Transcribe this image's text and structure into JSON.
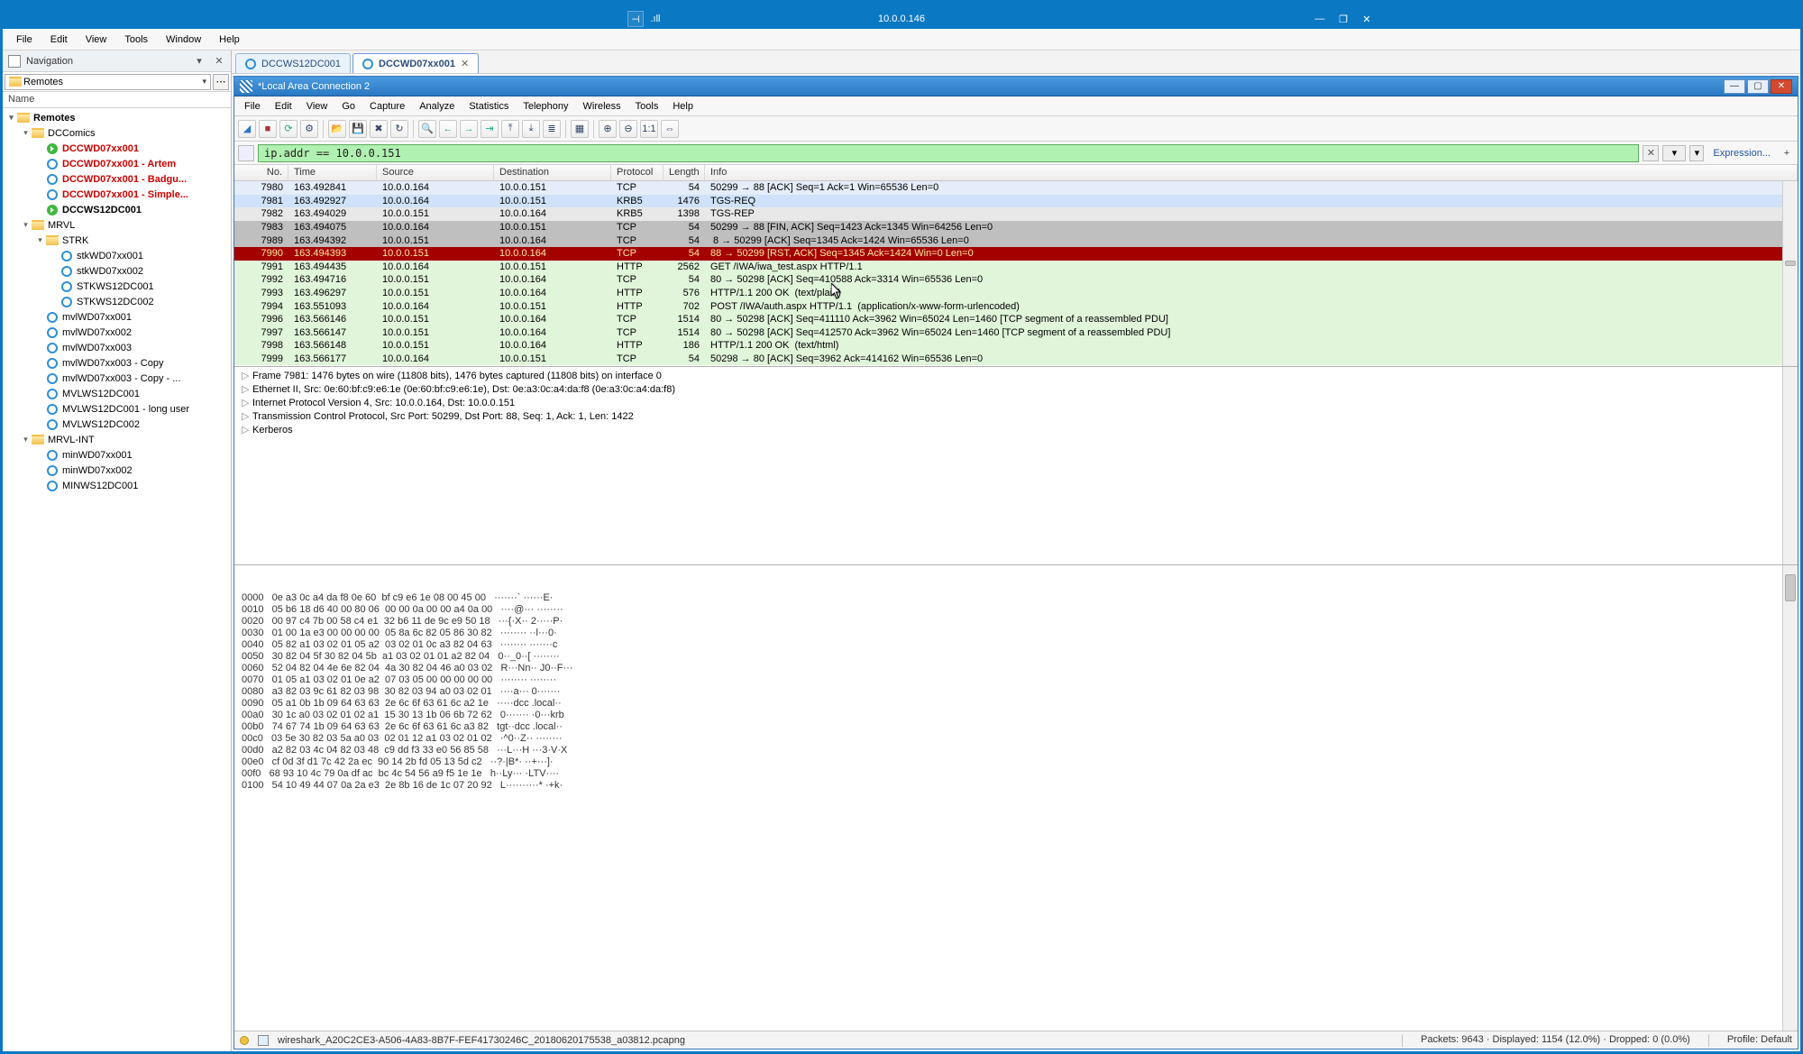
{
  "rdp": {
    "ip": "10.0.0.146",
    "pin_icon": "⊣",
    "signal_icon": "▮▮▮"
  },
  "app_menu": [
    "File",
    "Edit",
    "View",
    "Tools",
    "Window",
    "Help"
  ],
  "nav": {
    "title": "Navigation",
    "combo": "Remotes",
    "col": "Name",
    "tree": [
      {
        "lvl": 0,
        "exp": "▾",
        "type": "folder",
        "label": "Remotes",
        "bold": true
      },
      {
        "lvl": 1,
        "exp": "▾",
        "type": "folder",
        "label": "DCComics"
      },
      {
        "lvl": 2,
        "exp": "",
        "type": "play",
        "label": "DCCWD07xx001",
        "red": true,
        "bold": true
      },
      {
        "lvl": 2,
        "exp": "",
        "type": "off",
        "label": "DCCWD07xx001 - Artem",
        "red": true
      },
      {
        "lvl": 2,
        "exp": "",
        "type": "off",
        "label": "DCCWD07xx001 - Badgu...",
        "red": true
      },
      {
        "lvl": 2,
        "exp": "",
        "type": "off",
        "label": "DCCWD07xx001 - Simple...",
        "red": true
      },
      {
        "lvl": 2,
        "exp": "",
        "type": "play",
        "label": "DCCWS12DC001",
        "bold": true
      },
      {
        "lvl": 1,
        "exp": "▾",
        "type": "folder",
        "label": "MRVL"
      },
      {
        "lvl": 2,
        "exp": "▾",
        "type": "folder",
        "label": "STRK"
      },
      {
        "lvl": 3,
        "exp": "",
        "type": "off",
        "label": "stkWD07xx001"
      },
      {
        "lvl": 3,
        "exp": "",
        "type": "off",
        "label": "stkWD07xx002"
      },
      {
        "lvl": 3,
        "exp": "",
        "type": "off",
        "label": "STKWS12DC001"
      },
      {
        "lvl": 3,
        "exp": "",
        "type": "off",
        "label": "STKWS12DC002"
      },
      {
        "lvl": 2,
        "exp": "",
        "type": "off",
        "label": "mvlWD07xx001"
      },
      {
        "lvl": 2,
        "exp": "",
        "type": "off",
        "label": "mvlWD07xx002"
      },
      {
        "lvl": 2,
        "exp": "",
        "type": "off",
        "label": "mvlWD07xx003"
      },
      {
        "lvl": 2,
        "exp": "",
        "type": "off",
        "label": "mvlWD07xx003 - Copy"
      },
      {
        "lvl": 2,
        "exp": "",
        "type": "off",
        "label": "mvlWD07xx003 - Copy - ..."
      },
      {
        "lvl": 2,
        "exp": "",
        "type": "off",
        "label": "MVLWS12DC001"
      },
      {
        "lvl": 2,
        "exp": "",
        "type": "off",
        "label": "MVLWS12DC001 - long user"
      },
      {
        "lvl": 2,
        "exp": "",
        "type": "off",
        "label": "MVLWS12DC002"
      },
      {
        "lvl": 1,
        "exp": "▾",
        "type": "folder",
        "label": "MRVL-INT"
      },
      {
        "lvl": 2,
        "exp": "",
        "type": "off",
        "label": "minWD07xx001"
      },
      {
        "lvl": 2,
        "exp": "",
        "type": "off",
        "label": "minWD07xx002"
      },
      {
        "lvl": 2,
        "exp": "",
        "type": "off",
        "label": "MINWS12DC001"
      }
    ]
  },
  "tabs": [
    {
      "label": "DCCWS12DC001",
      "active": false
    },
    {
      "label": "DCCWD07xx001",
      "active": true
    }
  ],
  "ws": {
    "title": "*Local Area Connection 2",
    "menu": [
      "File",
      "Edit",
      "View",
      "Go",
      "Capture",
      "Analyze",
      "Statistics",
      "Telephony",
      "Wireless",
      "Tools",
      "Help"
    ],
    "filter": "ip.addr == 10.0.0.151",
    "expression": "Expression...",
    "columns": [
      "No.",
      "Time",
      "Source",
      "Destination",
      "Protocol",
      "Length",
      "Info"
    ],
    "rows": [
      {
        "no": "7980",
        "time": "163.492841",
        "src": "10.0.0.164",
        "dst": "10.0.0.151",
        "proto": "TCP",
        "len": "54",
        "info": "50299 → 88 [ACK] Seq=1 Ack=1 Win=65536 Len=0",
        "cls": "bg-blue"
      },
      {
        "no": "7981",
        "time": "163.492927",
        "src": "10.0.0.164",
        "dst": "10.0.0.151",
        "proto": "KRB5",
        "len": "1476",
        "info": "TGS-REQ",
        "cls": "bg-sel"
      },
      {
        "no": "7982",
        "time": "163.494029",
        "src": "10.0.0.151",
        "dst": "10.0.0.164",
        "proto": "KRB5",
        "len": "1398",
        "info": "TGS-REP",
        "cls": "bg-lgrey"
      },
      {
        "no": "7983",
        "time": "163.494075",
        "src": "10.0.0.164",
        "dst": "10.0.0.151",
        "proto": "TCP",
        "len": "54",
        "info": "50299 → 88 [FIN, ACK] Seq=1423 Ack=1345 Win=64256 Len=0",
        "cls": "bg-grey"
      },
      {
        "no": "7989",
        "time": "163.494392",
        "src": "10.0.0.151",
        "dst": "10.0.0.164",
        "proto": "TCP",
        "len": "54",
        "info": " 8 → 50299 [ACK] Seq=1345 Ack=1424 Win=65536 Len=0",
        "cls": "bg-grey"
      },
      {
        "no": "7990",
        "time": "163.494393",
        "src": "10.0.0.151",
        "dst": "10.0.0.164",
        "proto": "TCP",
        "len": "54",
        "info": "88 → 50299 [RST, ACK] Seq=1345 Ack=1424 Win=0 Len=0",
        "cls": "bg-red"
      },
      {
        "no": "7991",
        "time": "163.494435",
        "src": "10.0.0.164",
        "dst": "10.0.0.151",
        "proto": "HTTP",
        "len": "2562",
        "info": "GET /IWA/iwa_test.aspx HTTP/1.1",
        "cls": "bg-green"
      },
      {
        "no": "7992",
        "time": "163.494716",
        "src": "10.0.0.151",
        "dst": "10.0.0.164",
        "proto": "TCP",
        "len": "54",
        "info": "80 → 50298 [ACK] Seq=410588 Ack=3314 Win=65536 Len=0",
        "cls": "bg-green"
      },
      {
        "no": "7993",
        "time": "163.496297",
        "src": "10.0.0.151",
        "dst": "10.0.0.164",
        "proto": "HTTP",
        "len": "576",
        "info": "HTTP/1.1 200 OK  (text/plain)",
        "cls": "bg-green"
      },
      {
        "no": "7994",
        "time": "163.551093",
        "src": "10.0.0.164",
        "dst": "10.0.0.151",
        "proto": "HTTP",
        "len": "702",
        "info": "POST /IWA/auth.aspx HTTP/1.1  (application/x-www-form-urlencoded)",
        "cls": "bg-green"
      },
      {
        "no": "7996",
        "time": "163.566146",
        "src": "10.0.0.151",
        "dst": "10.0.0.164",
        "proto": "TCP",
        "len": "1514",
        "info": "80 → 50298 [ACK] Seq=411110 Ack=3962 Win=65024 Len=1460 [TCP segment of a reassembled PDU]",
        "cls": "bg-green"
      },
      {
        "no": "7997",
        "time": "163.566147",
        "src": "10.0.0.151",
        "dst": "10.0.0.164",
        "proto": "TCP",
        "len": "1514",
        "info": "80 → 50298 [ACK] Seq=412570 Ack=3962 Win=65024 Len=1460 [TCP segment of a reassembled PDU]",
        "cls": "bg-green"
      },
      {
        "no": "7998",
        "time": "163.566148",
        "src": "10.0.0.151",
        "dst": "10.0.0.164",
        "proto": "HTTP",
        "len": "186",
        "info": "HTTP/1.1 200 OK  (text/html)",
        "cls": "bg-green"
      },
      {
        "no": "7999",
        "time": "163.566177",
        "src": "10.0.0.164",
        "dst": "10.0.0.151",
        "proto": "TCP",
        "len": "54",
        "info": "50298 → 80 [ACK] Seq=3962 Ack=414162 Win=65536 Len=0",
        "cls": "bg-green"
      }
    ],
    "details": [
      "Frame 7981: 1476 bytes on wire (11808 bits), 1476 bytes captured (11808 bits) on interface 0",
      "Ethernet II, Src: 0e:60:bf:c9:e6:1e (0e:60:bf:c9:e6:1e), Dst: 0e:a3:0c:a4:da:f8 (0e:a3:0c:a4:da:f8)",
      "Internet Protocol Version 4, Src: 10.0.0.164, Dst: 10.0.0.151",
      "Transmission Control Protocol, Src Port: 50299, Dst Port: 88, Seq: 1, Ack: 1, Len: 1422",
      "Kerberos"
    ],
    "hex": [
      "0000   0e a3 0c a4 da f8 0e 60  bf c9 e6 1e 08 00 45 00   ·······` ······E·",
      "0010   05 b6 18 d6 40 00 80 06  00 00 0a 00 00 a4 0a 00   ····@··· ········",
      "0020   00 97 c4 7b 00 58 c4 e1  32 b6 11 de 9c e9 50 18   ···{·X·· 2·····P·",
      "0030   01 00 1a e3 00 00 00 00  05 8a 6c 82 05 86 30 82   ········ ··l···0·",
      "0040   05 82 a1 03 02 01 05 a2  03 02 01 0c a3 82 04 63   ········ ·······c",
      "0050   30 82 04 5f 30 82 04 5b  a1 03 02 01 01 a2 82 04   0··_0··[ ········",
      "0060   52 04 82 04 4e 6e 82 04  4a 30 82 04 46 a0 03 02   R···Nn·· J0··F···",
      "0070   01 05 a1 03 02 01 0e a2  07 03 05 00 00 00 00 00   ········ ········",
      "0080   a3 82 03 9c 61 82 03 98  30 82 03 94 a0 03 02 01   ····a··· 0·······",
      "0090   05 a1 0b 1b 09 64 63 63  2e 6c 6f 63 61 6c a2 1e   ·····dcc .local··",
      "00a0   30 1c a0 03 02 01 02 a1  15 30 13 1b 06 6b 72 62   0······· ·0···krb",
      "00b0   74 67 74 1b 09 64 63 63  2e 6c 6f 63 61 6c a3 82   tgt··dcc .local··",
      "00c0   03 5e 30 82 03 5a a0 03  02 01 12 a1 03 02 01 02   ·^0··Z·· ········",
      "00d0   a2 82 03 4c 04 82 03 48  c9 dd f3 33 e0 56 85 58   ···L···H ···3·V·X",
      "00e0   cf 0d 3f d1 7c 42 2a ec  90 14 2b fd 05 13 5d c2   ··?·|B*· ··+···]·",
      "00f0   68 93 10 4c 79 0a df ac  bc 4c 54 56 a9 f5 1e 1e   h··Ly··· ·LTV····",
      "0100   54 10 49 44 07 0a 2a e3  2e 8b 16 de 1c 07 20 92   L··········* ·+k·"
    ],
    "status_file": "wireshark_A20C2CE3-A506-4A83-8B7F-FEF41730246C_20180620175538_a03812.pcapng",
    "status_packets": "Packets: 9643 · Displayed: 1154 (12.0%) · Dropped: 0 (0.0%)",
    "status_profile": "Profile: Default"
  }
}
